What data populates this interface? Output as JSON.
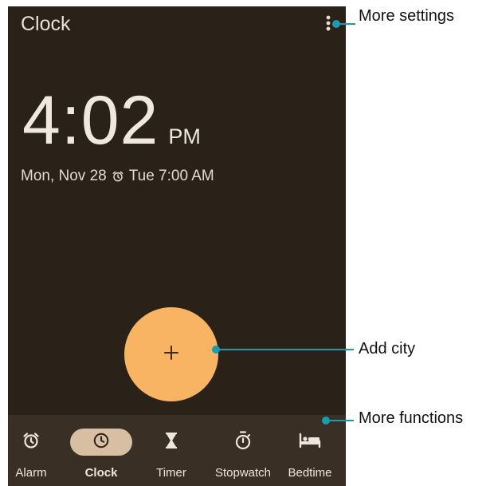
{
  "app": {
    "title": "Clock",
    "more_icon": "more-vert-icon"
  },
  "clock": {
    "time": "4:02",
    "ampm": "PM",
    "date": "Mon, Nov 28",
    "next_alarm_icon": "alarm-icon",
    "next_alarm": "Tue 7:00 AM"
  },
  "fab": {
    "label": "+",
    "icon": "plus-icon"
  },
  "nav": {
    "items": [
      {
        "label": "Alarm",
        "icon": "alarm-icon",
        "active": false
      },
      {
        "label": "Clock",
        "icon": "clock-icon",
        "active": true
      },
      {
        "label": "Timer",
        "icon": "hourglass-icon",
        "active": false
      },
      {
        "label": "Stopwatch",
        "icon": "stopwatch-icon",
        "active": false
      },
      {
        "label": "Bedtime",
        "icon": "bed-icon",
        "active": false
      }
    ]
  },
  "callouts": {
    "more_settings": "More settings",
    "add_city": "Add city",
    "more_functions": "More functions"
  },
  "colors": {
    "background": "#2a2219",
    "nav_background": "#3a2f25",
    "fab": "#f8b463",
    "active_pill": "#d8bfa3",
    "callout": "#1a9bb0"
  }
}
